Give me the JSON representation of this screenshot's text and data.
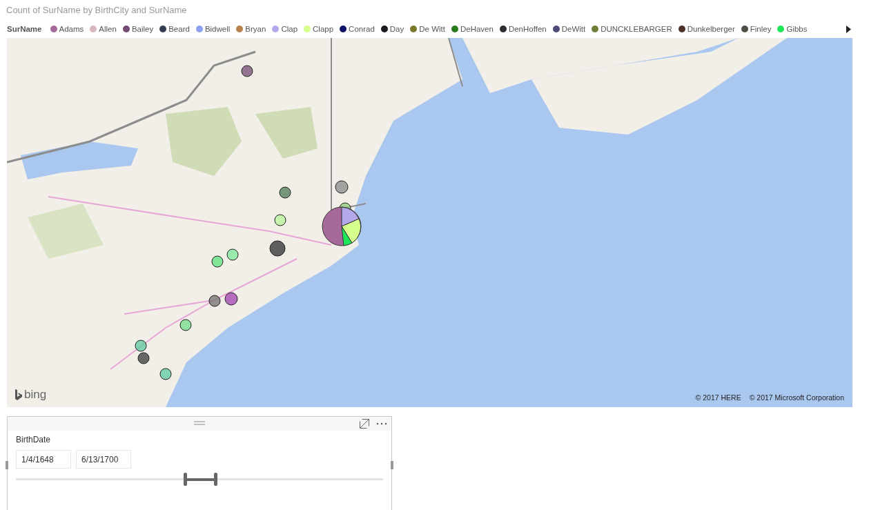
{
  "chart_title": "Count of SurName by BirthCity and SurName",
  "legend": {
    "title": "SurName",
    "items": [
      {
        "label": "Adams",
        "color": "#a66999"
      },
      {
        "label": "Allen",
        "color": "#d9b8bd"
      },
      {
        "label": "Bailey",
        "color": "#744a73"
      },
      {
        "label": "Beard",
        "color": "#333d4f"
      },
      {
        "label": "Bidwell",
        "color": "#8ba0ee"
      },
      {
        "label": "Bryan",
        "color": "#b8804a"
      },
      {
        "label": "Clap",
        "color": "#b4a7ea"
      },
      {
        "label": "Clapp",
        "color": "#d6ff8e"
      },
      {
        "label": "Conrad",
        "color": "#0c1266"
      },
      {
        "label": "Day",
        "color": "#1a1a1f"
      },
      {
        "label": "De Witt",
        "color": "#7a7a2a"
      },
      {
        "label": "DeHaven",
        "color": "#2a7a1e"
      },
      {
        "label": "DenHoffen",
        "color": "#2c2c33"
      },
      {
        "label": "DeWitt",
        "color": "#4e4a7a"
      },
      {
        "label": "DUNCKLEBARGER",
        "color": "#6b7e37"
      },
      {
        "label": "Dunkelberger",
        "color": "#4f3228"
      },
      {
        "label": "Finley",
        "color": "#4e5048"
      },
      {
        "label": "Gibbs",
        "color": "#1ee85a"
      }
    ]
  },
  "map": {
    "kind": "picture",
    "logo_text": "bing",
    "attributions": [
      "© 2017 HERE",
      "© 2017 Microsoft Corporation"
    ]
  },
  "slicer": {
    "title": "BirthDate",
    "start": "1/4/1648",
    "end": "6/13/1700",
    "thumbs": [
      {
        "level": 0.46
      },
      {
        "level": 0.543
      }
    ]
  }
}
